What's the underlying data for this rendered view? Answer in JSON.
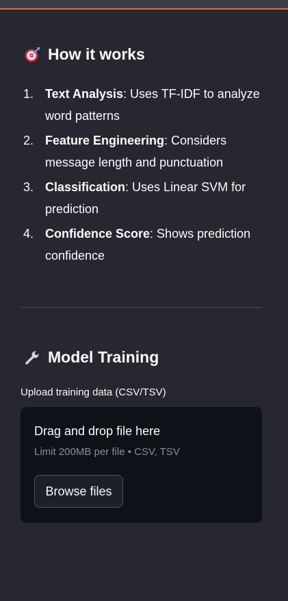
{
  "how_it_works": {
    "icon": "dart-target-icon",
    "title": "How it works",
    "steps": [
      {
        "number": "1.",
        "bold": "Text Analysis",
        "text": ": Uses TF-IDF to analyze word patterns"
      },
      {
        "number": "2.",
        "bold": "Feature Engineering",
        "text": ": Considers message length and punctuation"
      },
      {
        "number": "3.",
        "bold": "Classification",
        "text": ": Uses Linear SVM for prediction"
      },
      {
        "number": "4.",
        "bold": "Confidence Score",
        "text": ": Shows prediction confidence"
      }
    ]
  },
  "model_training": {
    "icon": "wrench-icon",
    "title": "Model Training",
    "upload_label": "Upload training data (CSV/TSV)",
    "dropzone": {
      "title": "Drag and drop file here",
      "limit": "Limit 200MB per file • CSV, TSV",
      "browse_label": "Browse files"
    }
  },
  "colors": {
    "background": "#262730",
    "accent": "#e8674f",
    "dropzone": "#0e1117",
    "muted_text": "#8a8e98"
  }
}
